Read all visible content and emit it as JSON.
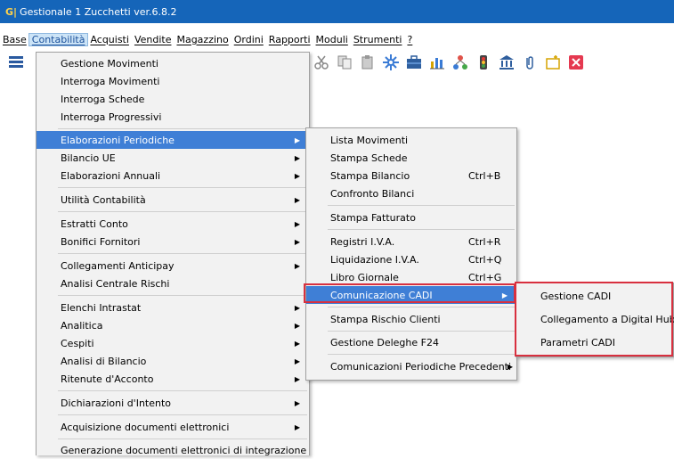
{
  "window": {
    "logo": "G|",
    "title": "Gestionale 1 Zucchetti ver.6.8.2"
  },
  "menubar": [
    "Base",
    "Contabilità",
    "Acquisti",
    "Vendite",
    "Magazzino",
    "Ordini",
    "Rapporti",
    "Moduli",
    "Strumenti",
    "?"
  ],
  "menubar_active": "Contabilità",
  "contabilita_menu": {
    "items": [
      {
        "label": "Gestione Movimenti"
      },
      {
        "label": "Interroga Movimenti"
      },
      {
        "label": "Interroga Schede"
      },
      {
        "label": "Interroga Progressivi"
      },
      {
        "label": "Elaborazioni Periodiche",
        "submenu": true,
        "highlighted": true
      },
      {
        "label": "Bilancio UE",
        "submenu": true
      },
      {
        "label": "Elaborazioni Annuali",
        "submenu": true
      },
      {
        "label": "Utilità Contabilità",
        "submenu": true
      },
      {
        "label": "Estratti Conto",
        "submenu": true
      },
      {
        "label": "Bonifici Fornitori",
        "submenu": true
      },
      {
        "label": "Collegamenti Anticipay",
        "submenu": true
      },
      {
        "label": "Analisi Centrale Rischi"
      },
      {
        "label": "Elenchi Intrastat",
        "submenu": true
      },
      {
        "label": "Analitica",
        "submenu": true
      },
      {
        "label": "Cespiti",
        "submenu": true
      },
      {
        "label": "Analisi di Bilancio",
        "submenu": true
      },
      {
        "label": "Ritenute d'Acconto",
        "submenu": true
      },
      {
        "label": "Dichiarazioni d'Intento",
        "submenu": true
      },
      {
        "label": "Acquisizione documenti elettronici",
        "submenu": true
      },
      {
        "label": "Generazione documenti elettronici di integrazione"
      }
    ]
  },
  "elaborazioni_menu": {
    "items": [
      {
        "label": "Lista Movimenti"
      },
      {
        "label": "Stampa Schede"
      },
      {
        "label": "Stampa Bilancio",
        "shortcut": "Ctrl+B"
      },
      {
        "label": "Confronto Bilanci"
      },
      {
        "label": "Stampa Fatturato"
      },
      {
        "label": "Registri I.V.A.",
        "shortcut": "Ctrl+R"
      },
      {
        "label": "Liquidazione I.V.A.",
        "shortcut": "Ctrl+Q"
      },
      {
        "label": "Libro Giornale",
        "shortcut": "Ctrl+G"
      },
      {
        "label": "Comunicazione CADI",
        "submenu": true,
        "highlighted": true
      },
      {
        "label": "Stampa Rischio Clienti"
      },
      {
        "label": "Gestione Deleghe F24"
      },
      {
        "label": "Comunicazioni Periodiche Precedenti",
        "submenu": true
      }
    ]
  },
  "cadi_menu": {
    "items": [
      {
        "label": "Gestione CADI"
      },
      {
        "label": "Collegamento a Digital Hub"
      },
      {
        "label": "Parametri CADI"
      }
    ]
  },
  "toolbar_icons": [
    "menu-icon",
    "cut-icon",
    "copy-icon",
    "paste-icon",
    "settings-icon",
    "briefcase-icon",
    "chart-icon",
    "network-icon",
    "traffic-light-icon",
    "bank-icon",
    "attachment-icon",
    "folder-new-icon",
    "close-icon"
  ],
  "colors": {
    "titlebar": "#1565b9",
    "highlight": "#3f7fd6",
    "annotation": "#d8303f"
  }
}
